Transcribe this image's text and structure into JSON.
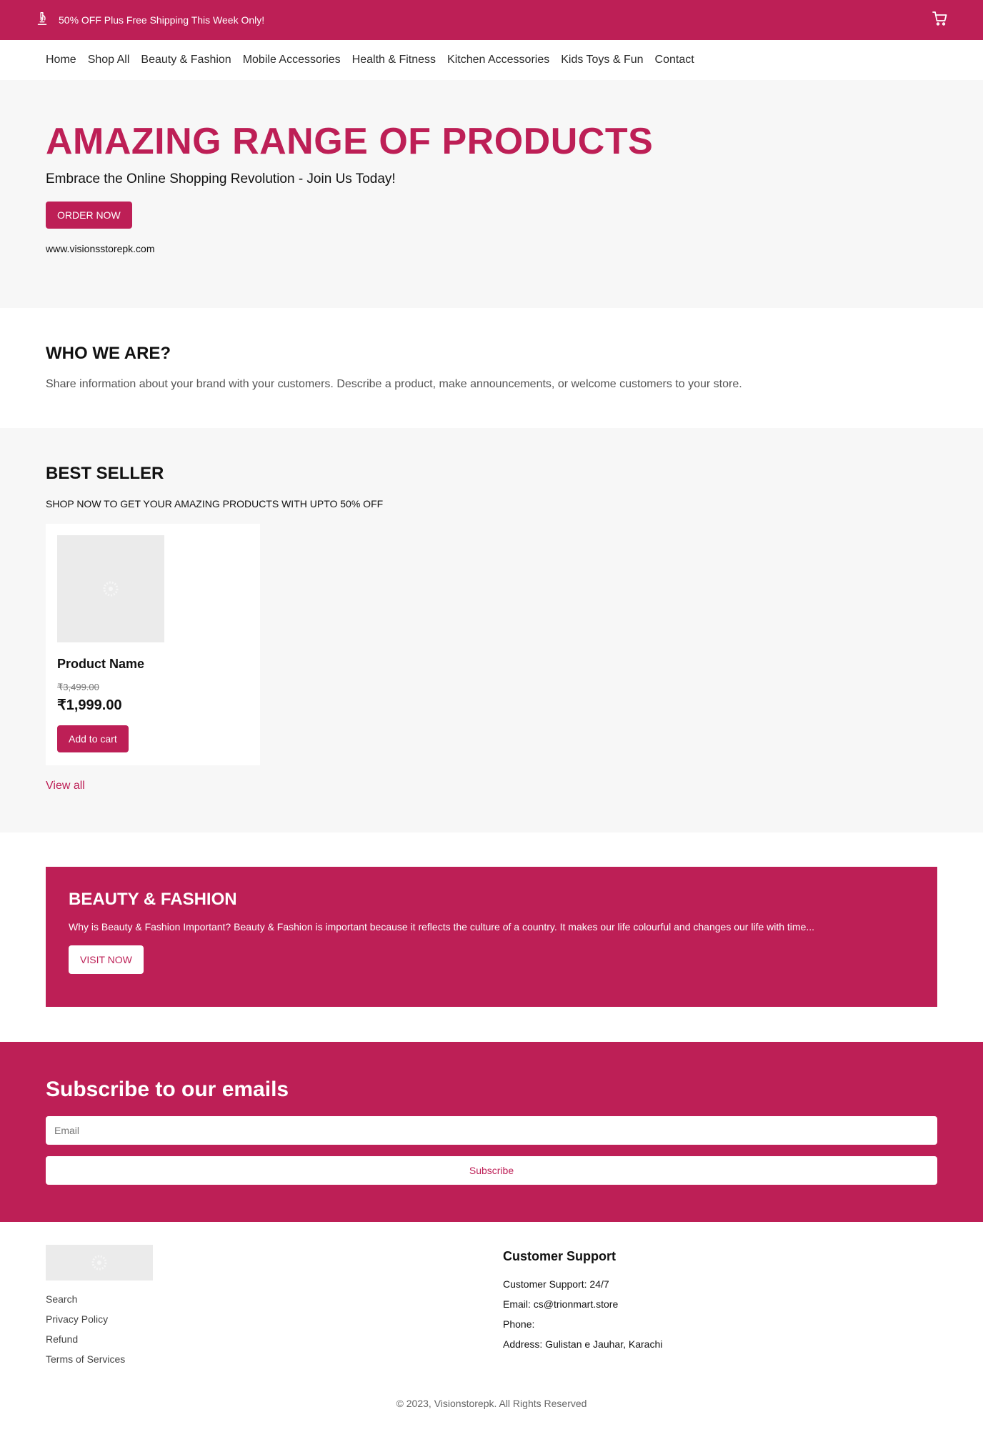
{
  "announcement": {
    "icon": "microscope-icon",
    "text": "50% OFF Plus Free Shipping This Week Only!",
    "cart_icon": "cart-icon"
  },
  "nav": {
    "items": [
      "Home",
      "Shop All",
      "Beauty & Fashion",
      "Mobile Accessories",
      "Health & Fitness",
      "Kitchen Accessories",
      "Kids Toys & Fun",
      "Contact"
    ]
  },
  "hero": {
    "title": "AMAZING RANGE OF PRODUCTS",
    "subtitle": "Embrace the Online Shopping Revolution - Join Us Today!",
    "button": "ORDER NOW",
    "url": "www.visionsstorepk.com"
  },
  "who": {
    "title": "WHO WE ARE?",
    "text": "Share information about your brand with your customers. Describe a product, make announcements, or welcome customers to your store."
  },
  "best_seller": {
    "title": "BEST SELLER",
    "tagline": "SHOP NOW TO GET YOUR AMAZING PRODUCTS WITH UPTO 50% OFF",
    "product": {
      "name": "Product Name",
      "old_price": "₹3,499.00",
      "price": "₹1,999.00",
      "button": "Add to cart"
    },
    "view_all": "View all"
  },
  "promo": {
    "title": "BEAUTY & FASHION",
    "text": "Why is Beauty & Fashion Important? Beauty & Fashion is important because it reflects the culture of a country. It makes our life colourful and changes our life with time...",
    "button": "VISIT NOW"
  },
  "subscribe": {
    "title": "Subscribe to our emails",
    "placeholder": "Email",
    "button": "Subscribe"
  },
  "footer": {
    "links": [
      "Search",
      "Privacy Policy",
      "Refund",
      "Terms of Services"
    ],
    "support_title": "Customer Support",
    "support_lines": [
      "Customer Support: 24/7",
      "Email: cs@trionmart.store",
      "Phone:",
      "Address: Gulistan e Jauhar, Karachi"
    ],
    "copyright": "© 2023, Visionstorepk. All Rights Reserved"
  },
  "colors": {
    "brand": "#bd1f56",
    "section_bg": "#f7f7f7",
    "placeholder_bg": "#ebebeb"
  }
}
